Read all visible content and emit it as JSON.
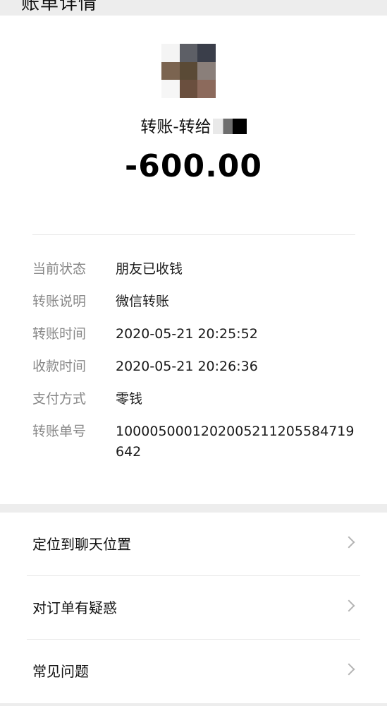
{
  "header": {
    "title": "账单详情"
  },
  "transfer": {
    "title": "转账-转给",
    "amount": "-600.00"
  },
  "details": [
    {
      "label": "当前状态",
      "value": "朋友已收钱"
    },
    {
      "label": "转账说明",
      "value": "微信转账"
    },
    {
      "label": "转账时间",
      "value": "2020-05-21 20:25:52"
    },
    {
      "label": "收款时间",
      "value": "2020-05-21 20:26:36"
    },
    {
      "label": "支付方式",
      "value": "零钱"
    },
    {
      "label": "转账单号",
      "value": "1000050001202005211205584719642"
    }
  ],
  "menu": [
    {
      "label": "定位到聊天位置",
      "icon": "chevron-right-icon"
    },
    {
      "label": "对订单有疑惑",
      "icon": "chevron-right-icon"
    },
    {
      "label": "常见问题",
      "icon": "chevron-right-icon"
    }
  ],
  "colors": {
    "background": "#ededed",
    "card": "#ffffff",
    "label_gray": "#888888",
    "text": "#111111",
    "chevron": "#b4b4b4"
  }
}
